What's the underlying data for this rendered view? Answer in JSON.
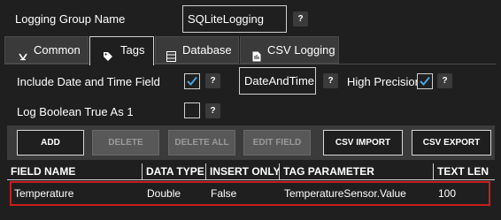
{
  "group": {
    "label": "Logging Group Name",
    "value": "SQLiteLogging",
    "help": "?"
  },
  "tabs": [
    {
      "label": "Common",
      "icon": "arrow-icon"
    },
    {
      "label": "Tags",
      "icon": "tag-icon"
    },
    {
      "label": "Database",
      "icon": "database-icon"
    },
    {
      "label": "CSV Logging",
      "icon": "csv-file-icon"
    }
  ],
  "active_tab": "Tags",
  "options": {
    "include_date_label": "Include Date and Time Field",
    "include_date_checked": true,
    "include_date_help": "?",
    "date_field_value": "DateAndTime",
    "date_field_help": "?",
    "high_precision_label": "High Precision",
    "high_precision_checked": true,
    "high_precision_help": "?",
    "log_boolean_label": "Log Boolean True As 1",
    "log_boolean_checked": false,
    "log_boolean_help": "?"
  },
  "toolbar": {
    "add": "ADD",
    "delete": "DELETE",
    "delete_all": "DELETE ALL",
    "edit_field": "EDIT FIELD",
    "csv_import": "CSV IMPORT",
    "csv_export": "CSV EXPORT"
  },
  "table": {
    "columns": [
      "FIELD NAME",
      "DATA TYPE",
      "INSERT ONLY",
      "TAG PARAMETER",
      "TEXT LEN"
    ],
    "rows": [
      [
        "Temperature",
        "Double",
        "False",
        "TemperatureSensor.Value",
        "100"
      ]
    ]
  },
  "colors": {
    "background": "#1f1f1f",
    "check_accent": "#4ba3e3",
    "selection_border": "#c81e1e"
  }
}
